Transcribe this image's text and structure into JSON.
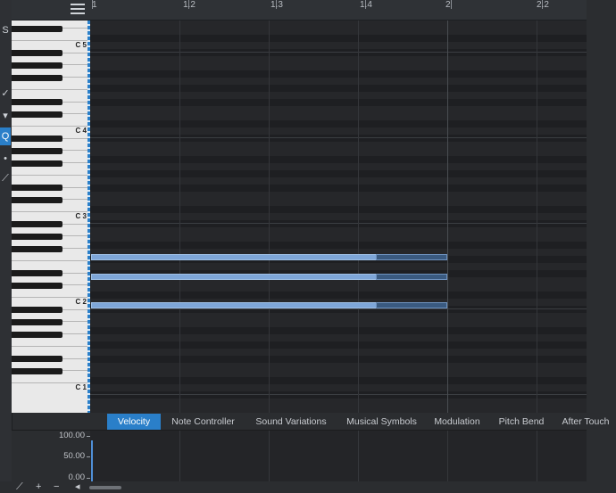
{
  "tools": [
    "S",
    "✓",
    "▾",
    "Q",
    "•",
    "⟋"
  ],
  "ruler": {
    "labels": [
      "1",
      "1.2",
      "1.3",
      "1.4",
      "2",
      "2.2"
    ]
  },
  "keyboard": {
    "c_labels": [
      "C 5",
      "C 4",
      "C 3",
      "C 2",
      "C 1"
    ]
  },
  "tabs": {
    "more": "...",
    "items": [
      "Velocity",
      "Note Controller",
      "Sound Variations",
      "Musical Symbols",
      "Modulation",
      "Pitch Bend",
      "After Touch"
    ],
    "active": 0
  },
  "lane": {
    "axis_labels": [
      "100.00",
      "50.00",
      "0.00"
    ]
  },
  "bottom": {
    "icons": [
      "⟋",
      "+",
      "−",
      "◂"
    ]
  }
}
